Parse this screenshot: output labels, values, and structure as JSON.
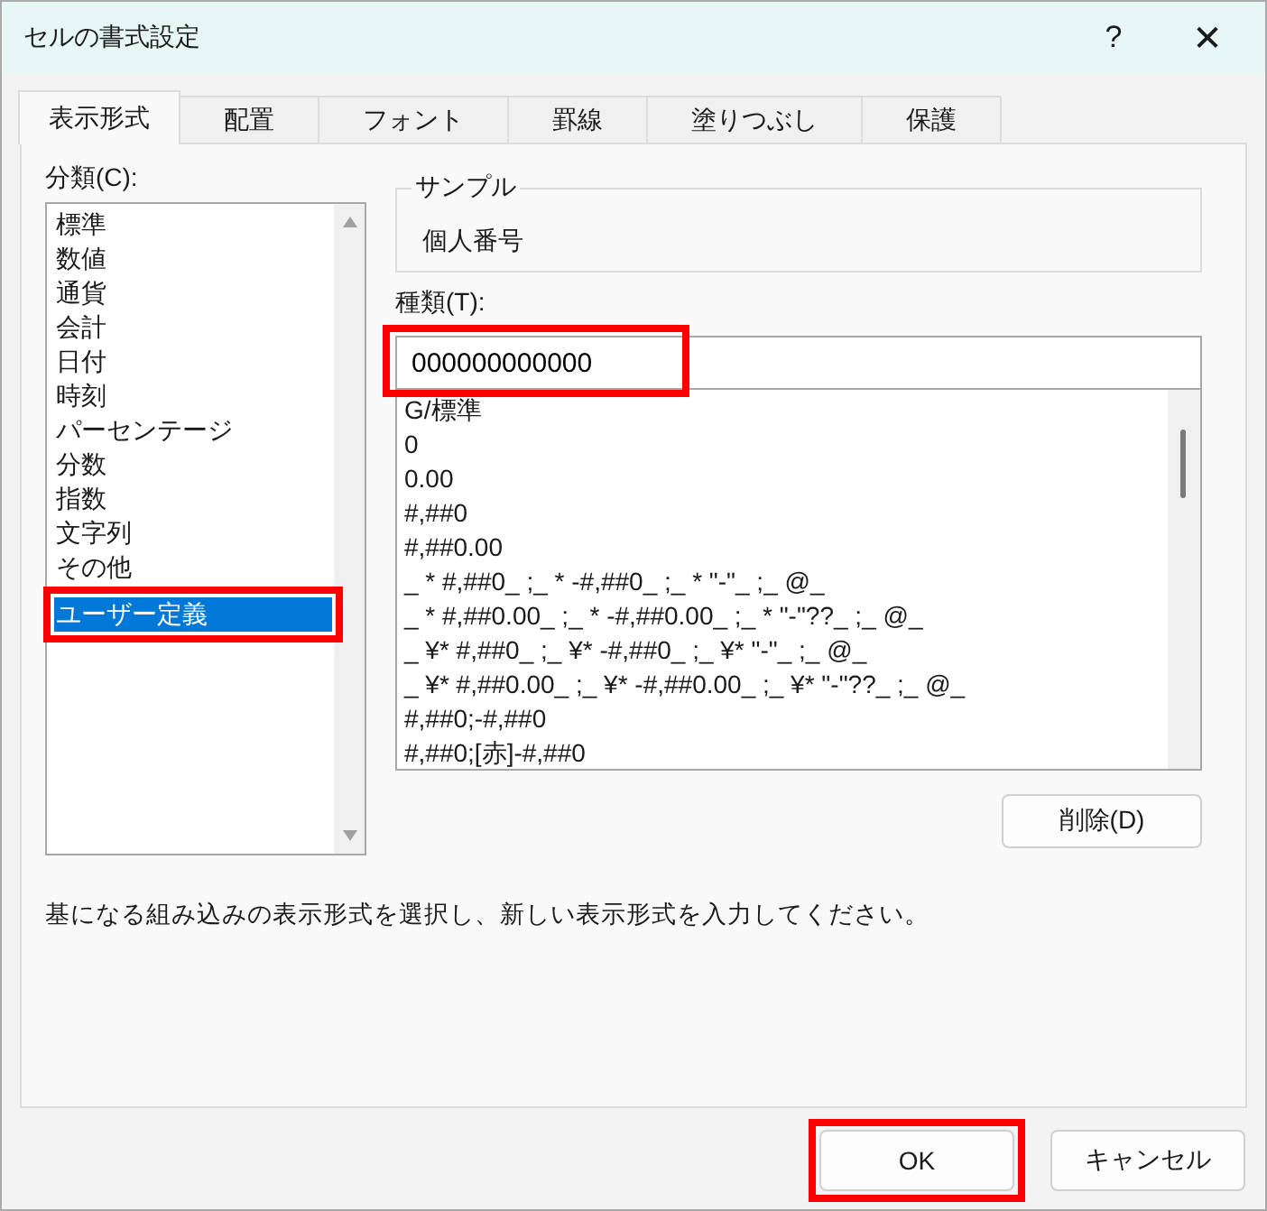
{
  "window": {
    "title": "セルの書式設定",
    "help": "?",
    "close": "✕"
  },
  "tabs": [
    {
      "label": "表示形式",
      "selected": true
    },
    {
      "label": "配置",
      "selected": false
    },
    {
      "label": "フォント",
      "selected": false
    },
    {
      "label": "罫線",
      "selected": false
    },
    {
      "label": "塗りつぶし",
      "selected": false
    },
    {
      "label": "保護",
      "selected": false
    }
  ],
  "category": {
    "label": "分類(C):",
    "items": [
      {
        "label": "標準",
        "selected": false,
        "highlighted": false
      },
      {
        "label": "数値",
        "selected": false,
        "highlighted": false
      },
      {
        "label": "通貨",
        "selected": false,
        "highlighted": false
      },
      {
        "label": "会計",
        "selected": false,
        "highlighted": false
      },
      {
        "label": "日付",
        "selected": false,
        "highlighted": false
      },
      {
        "label": "時刻",
        "selected": false,
        "highlighted": false
      },
      {
        "label": "パーセンテージ",
        "selected": false,
        "highlighted": false
      },
      {
        "label": "分数",
        "selected": false,
        "highlighted": false
      },
      {
        "label": "指数",
        "selected": false,
        "highlighted": false
      },
      {
        "label": "文字列",
        "selected": false,
        "highlighted": false
      },
      {
        "label": "その他",
        "selected": false,
        "highlighted": false
      },
      {
        "label": "ユーザー定義",
        "selected": true,
        "highlighted": true
      }
    ]
  },
  "sample": {
    "label": "サンプル",
    "value": "個人番号"
  },
  "type": {
    "label": "種類(T):",
    "value": "000000000000",
    "highlighted": true
  },
  "formats": [
    "G/標準",
    "0",
    "0.00",
    "#,##0",
    "#,##0.00",
    "_ * #,##0_ ;_ * -#,##0_ ;_ * \"-\"_ ;_ @_",
    "_ * #,##0.00_ ;_ * -#,##0.00_ ;_ * \"-\"??_ ;_ @_",
    "_ ¥* #,##0_ ;_ ¥* -#,##0_ ;_ ¥* \"-\"_ ;_ @_",
    "_ ¥* #,##0.00_ ;_ ¥* -#,##0.00_ ;_ ¥* \"-\"??_ ;_ @_",
    "#,##0;-#,##0",
    "#,##0;[赤]-#,##0"
  ],
  "delete_button": "削除(D)",
  "description": "基になる組み込みの表示形式を選択し、新しい表示形式を入力してください。",
  "buttons": [
    {
      "label": "OK",
      "highlighted": true
    },
    {
      "label": "キャンセル",
      "highlighted": false
    }
  ]
}
